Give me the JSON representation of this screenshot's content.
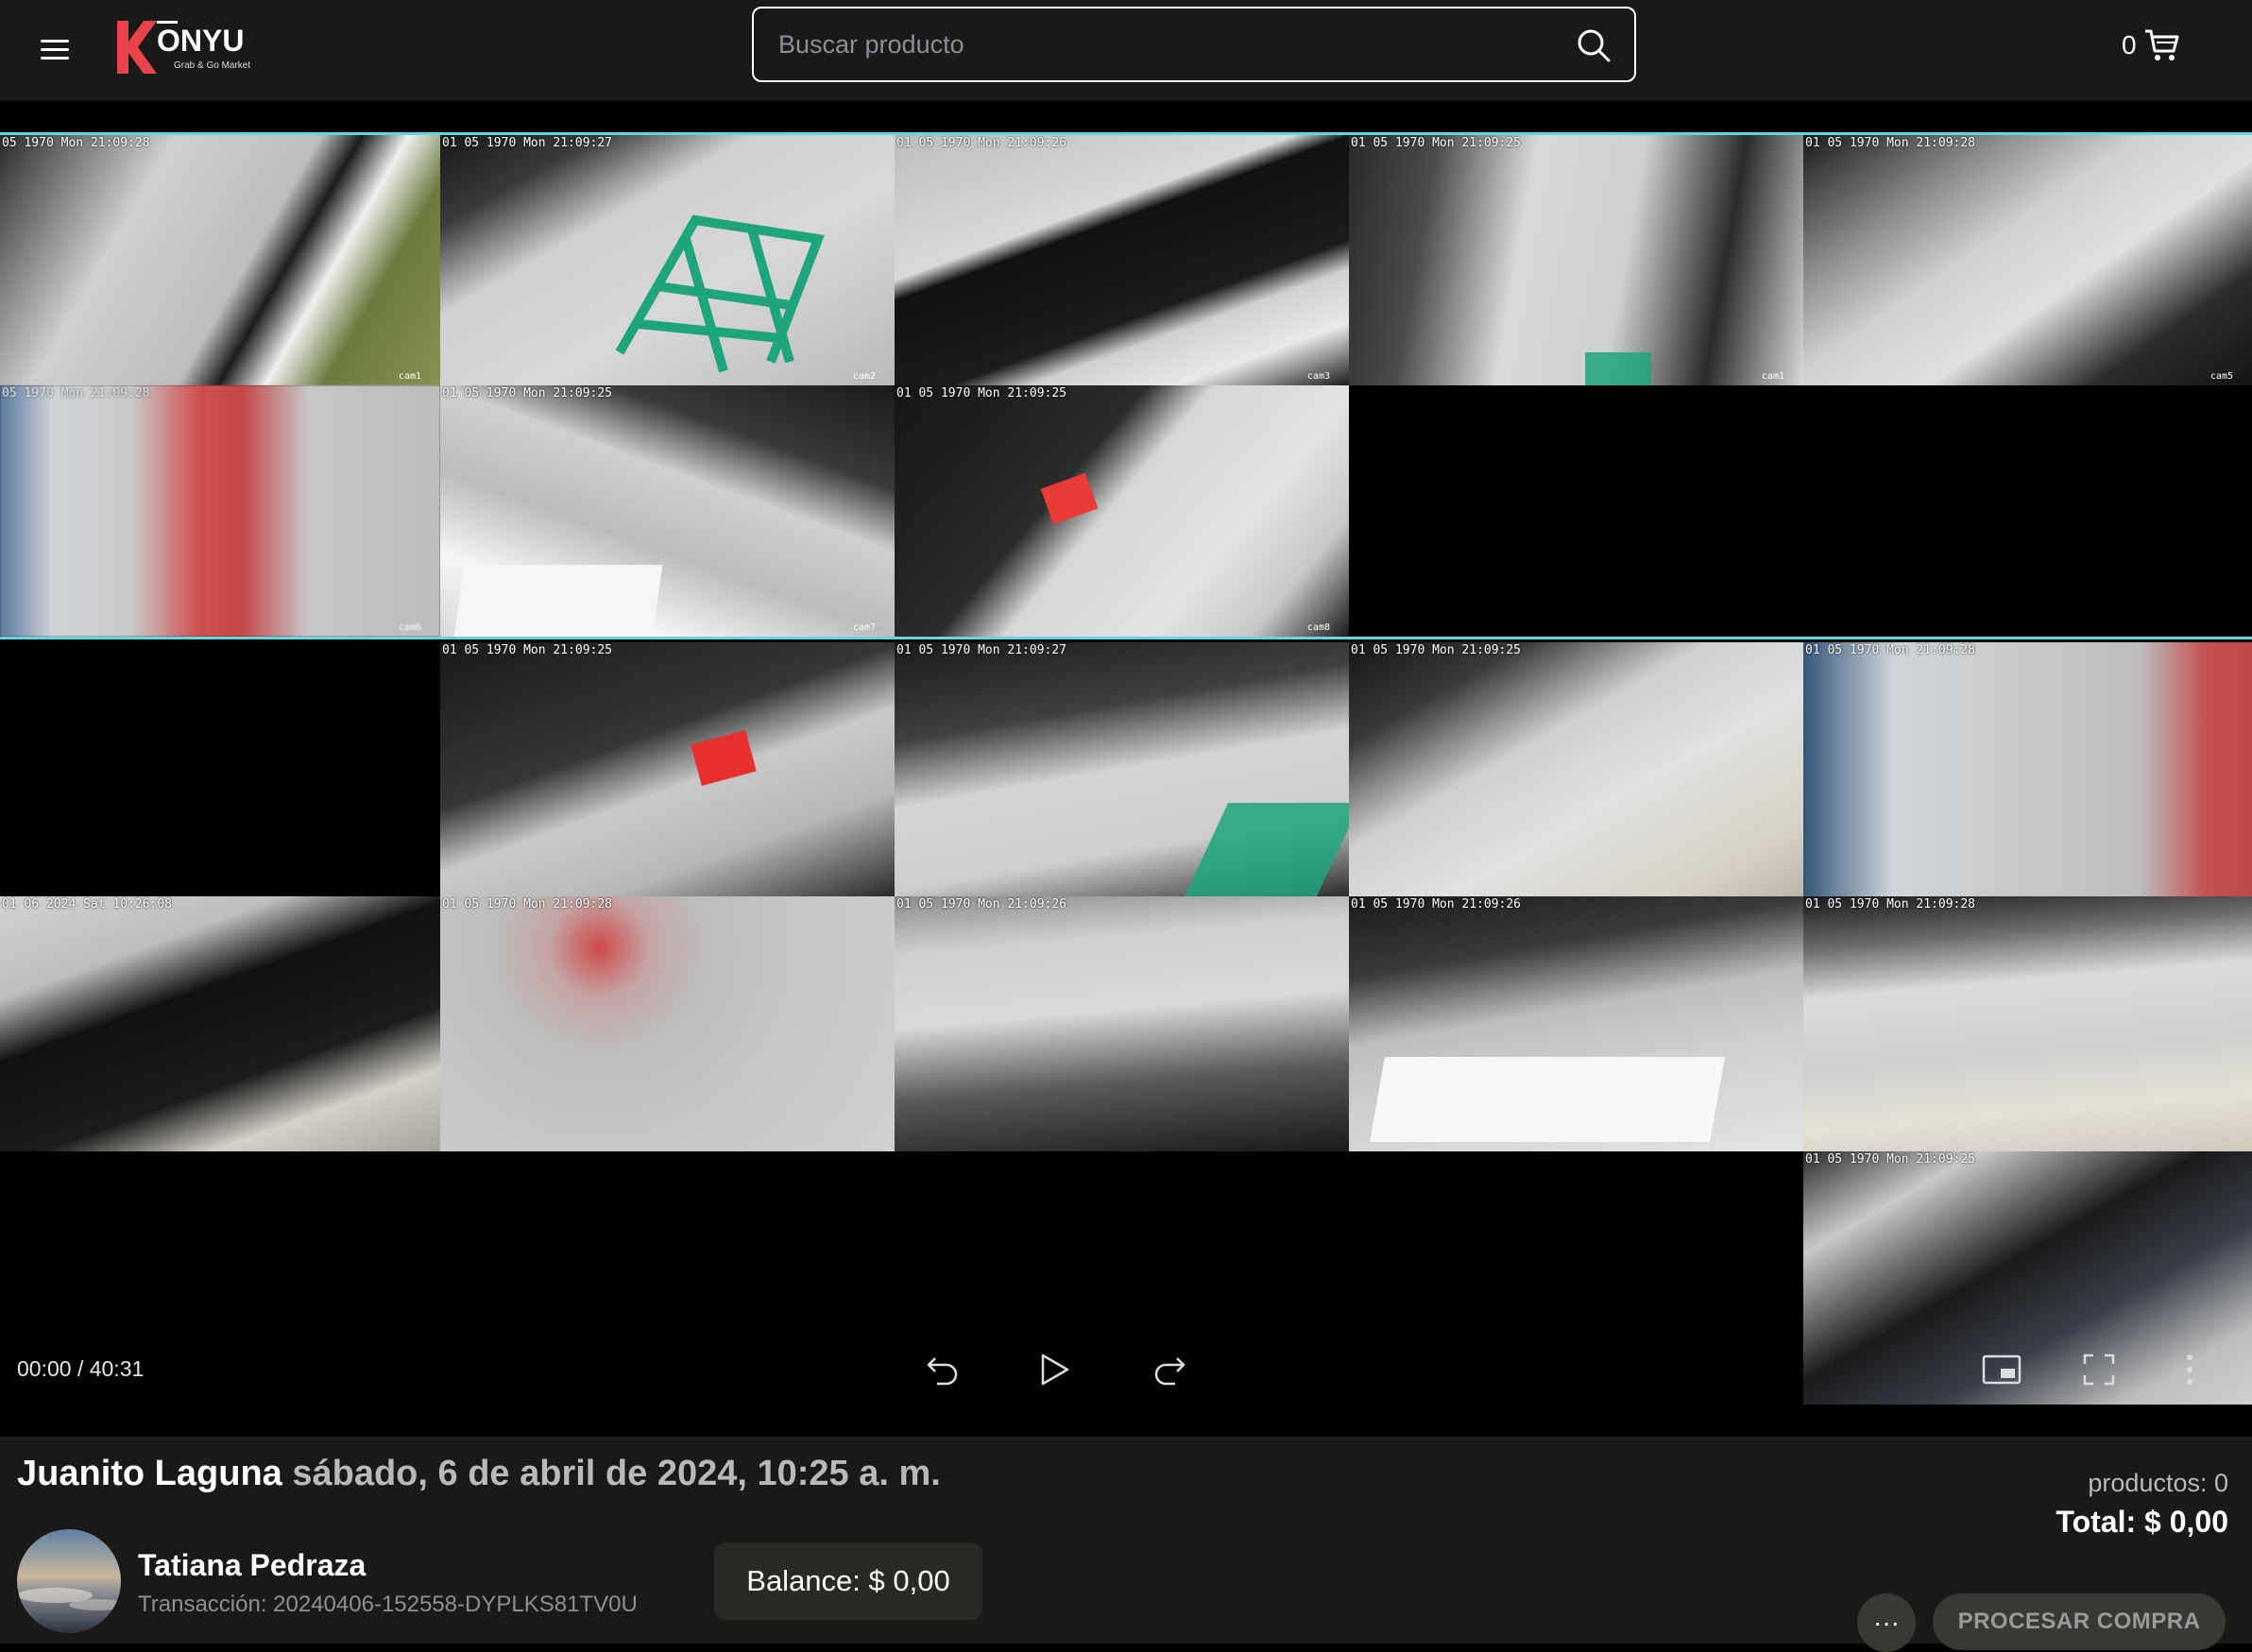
{
  "header": {
    "brand": "KONYU",
    "tagline": "Grab & Go Market",
    "search_placeholder": "Buscar producto",
    "cart_count": "0"
  },
  "cameras": {
    "row1": [
      "05 1970 Mon 21:09:28",
      "01 05 1970 Mon 21:09:27",
      "01 05 1970 Mon 21:09:26",
      "01 05 1970 Mon 21:09:25",
      "01 05 1970 Mon 21:09:28"
    ],
    "row1_labels": [
      "cam1",
      "cam2",
      "cam3",
      "cam1",
      "cam5"
    ],
    "row2": [
      "05 1970 Mon 21:09:28",
      "01 05 1970 Mon 21:09:25",
      "01 05 1970 Mon 21:09:25"
    ],
    "row2_labels": [
      "cam6",
      "cam7",
      "cam8"
    ],
    "row3": [
      "01 05 1970 Mon 21:09:25",
      "01 05 1970 Mon 21:09:27",
      "01 05 1970 Mon 21:09:25",
      "01 05 1970 Mon 21:09:28"
    ],
    "row4": [
      "01 06 2024 Sat 10:26:08",
      "01 05 1970 Mon 21:09:28",
      "01 05 1970 Mon 21:09:26",
      "01 05 1970 Mon 21:09:26",
      "01 05 1970 Mon 21:09:28"
    ],
    "row5": [
      "01 05 1970 Mon 21:09:25"
    ]
  },
  "video": {
    "time": "00:00 / 40:31"
  },
  "footer": {
    "customer": "Juanito Laguna",
    "datetime": "sábado, 6 de abril de 2024, 10:25 a. m.",
    "operator": "Tatiana Pedraza",
    "transaction": "Transacción: 20240406-152558-DYPLKS81TV0U",
    "balance": "Balance: $ 0,00",
    "products": "productos: 0",
    "total": "Total: $ 0,00",
    "more_label": "···",
    "process_label": "PROCESAR COMPRA"
  },
  "colors": {
    "bar_bg": "#1b1917",
    "brand_red": "#e8434a",
    "cyan_divider": "#5fd6e3",
    "shelf_green": "#1fa57c"
  }
}
